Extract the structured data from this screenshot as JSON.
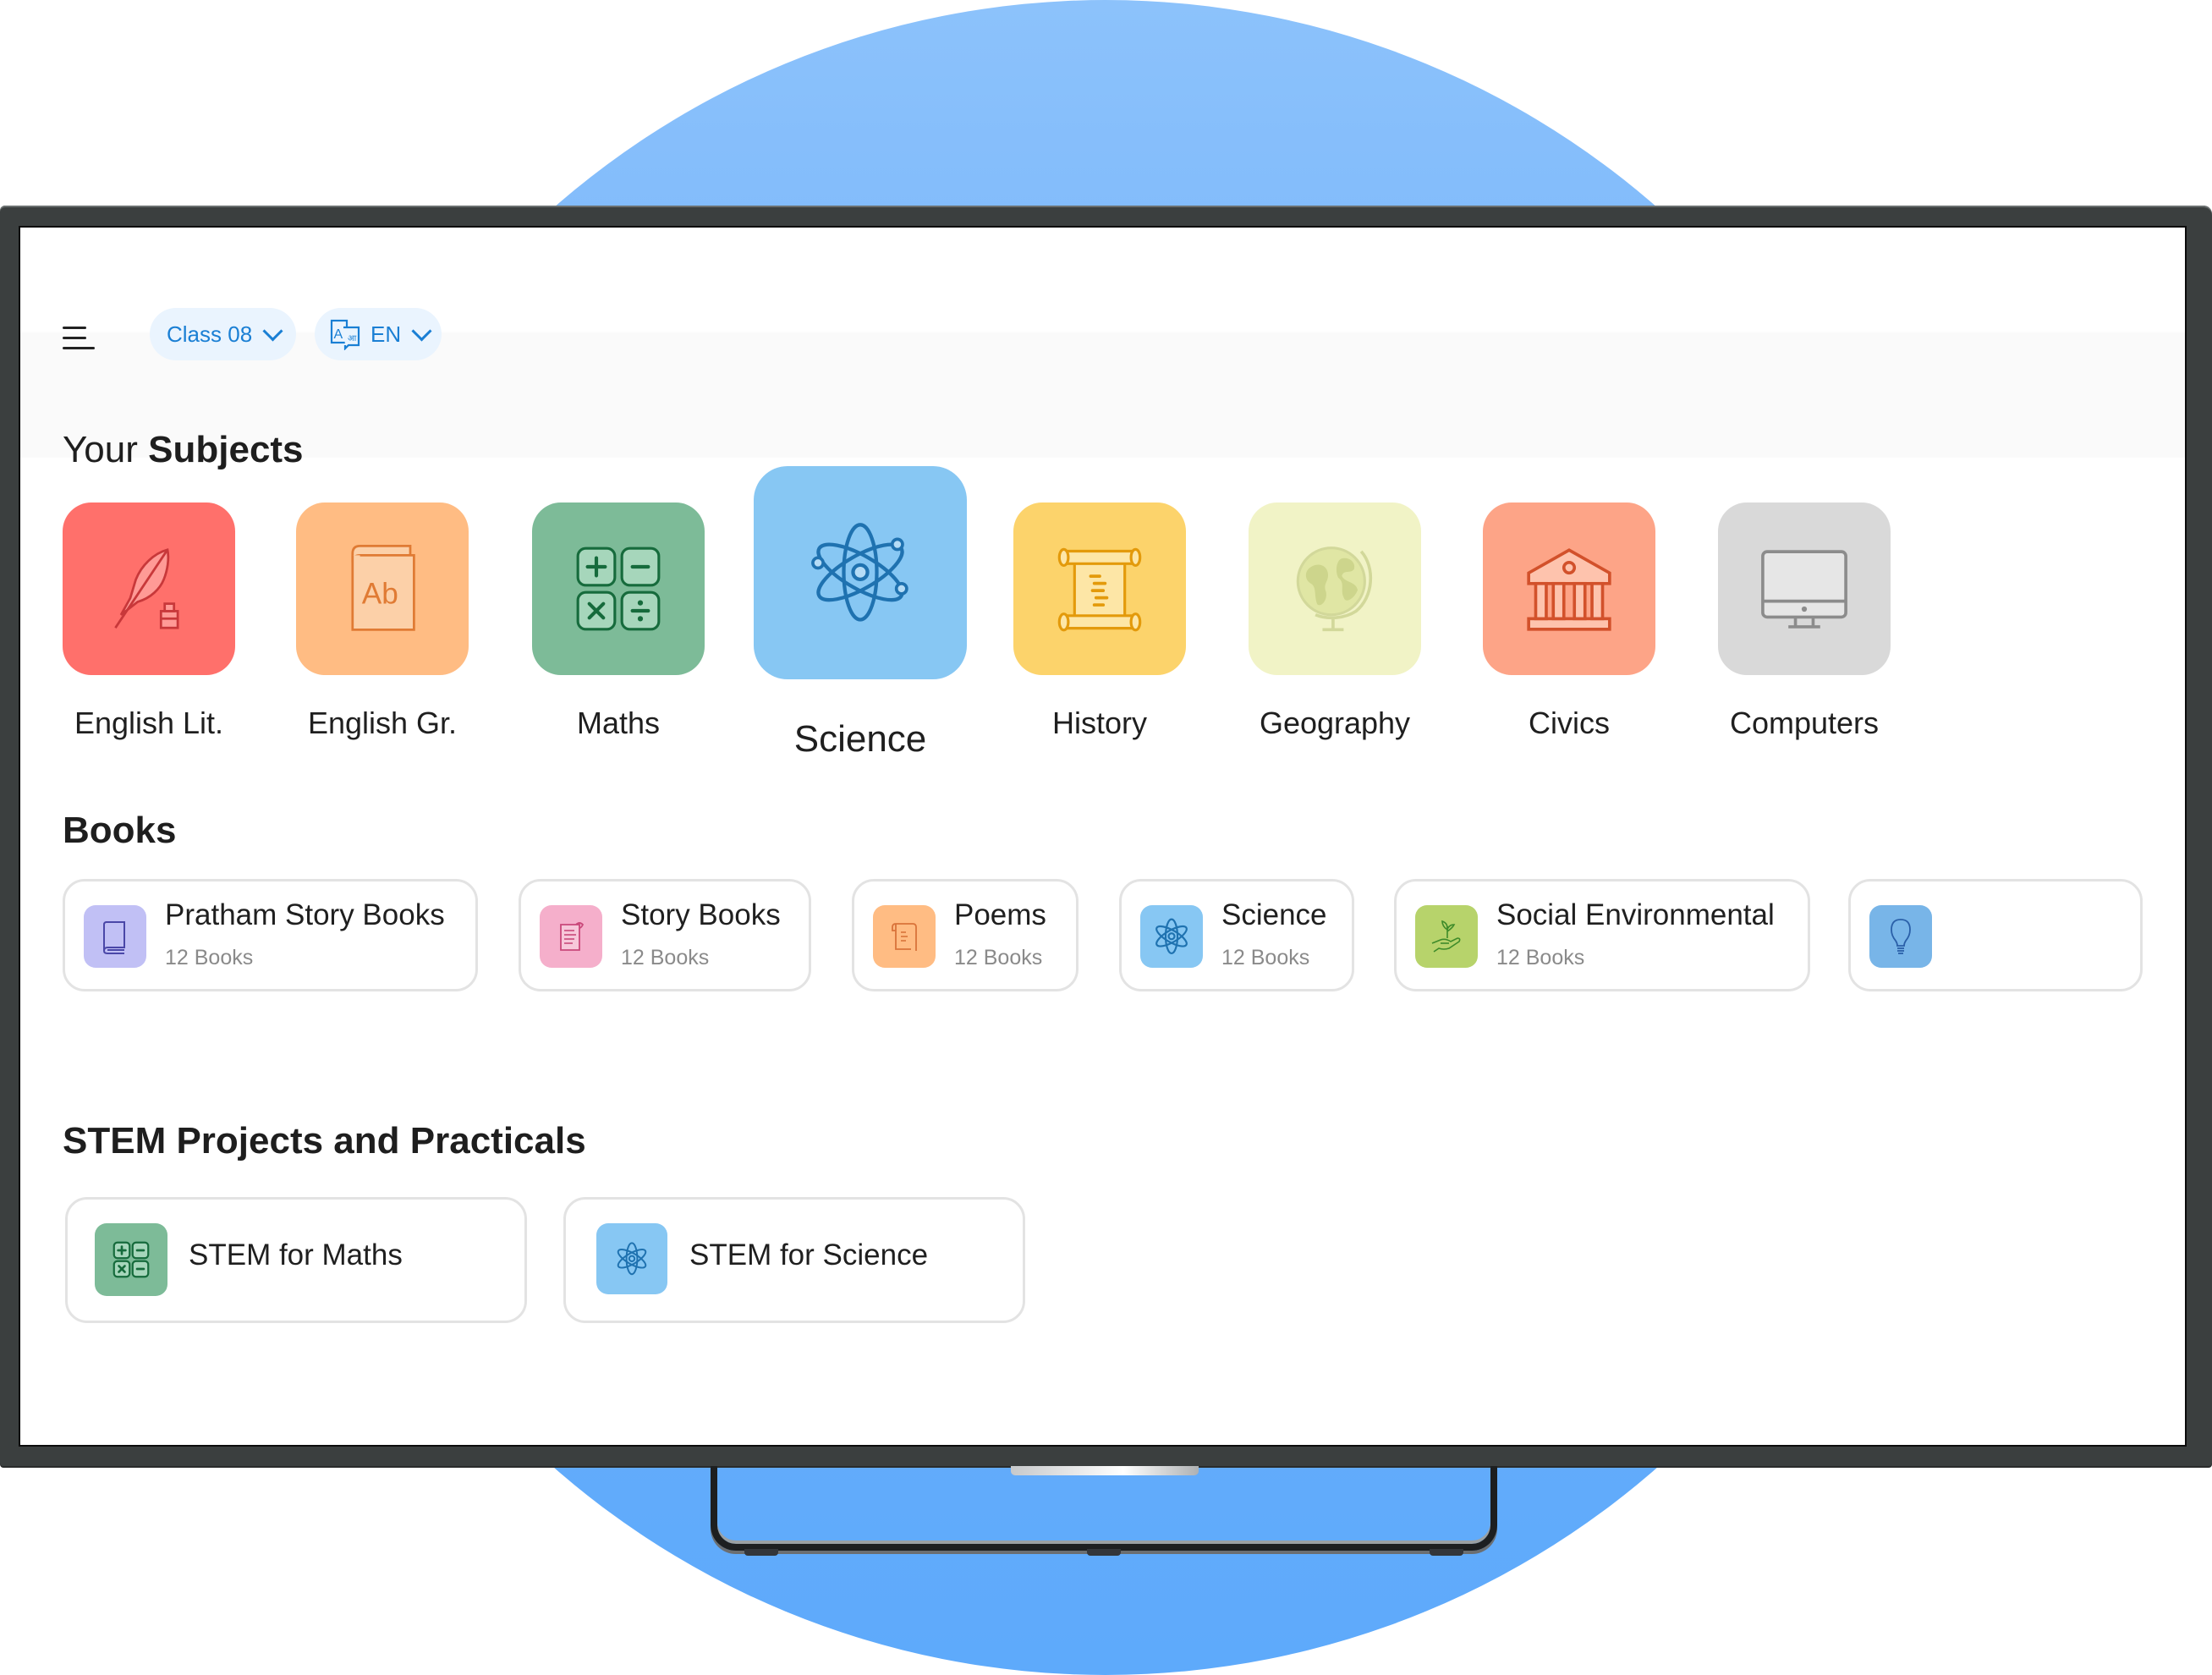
{
  "header": {
    "menu_icon": "hamburger-menu-icon",
    "class_selector": {
      "value": "Class 08",
      "icon": "chevron-down-icon"
    },
    "language_selector": {
      "value": "EN",
      "icon": "translate-icon"
    }
  },
  "subjects_section": {
    "title_prefix": "Your",
    "title_bold": "Subjects",
    "items": [
      {
        "label": "English Lit.",
        "icon": "quill-ink-icon",
        "color": "#ff706b"
      },
      {
        "label": "English Gr.",
        "icon": "grammar-book-icon",
        "color": "#ffbc83"
      },
      {
        "label": "Maths",
        "icon": "calculator-icon",
        "color": "#7dbb98"
      },
      {
        "label": "Science",
        "icon": "atom-icon",
        "color": "#87c7f3",
        "selected": true
      },
      {
        "label": "History",
        "icon": "scroll-icon",
        "color": "#fcd36b"
      },
      {
        "label": "Geography",
        "icon": "globe-icon",
        "color": "#f1f3c6"
      },
      {
        "label": "Civics",
        "icon": "government-building-icon",
        "color": "#fda487"
      },
      {
        "label": "Computers",
        "icon": "desktop-computer-icon",
        "color": "#d9d9d9"
      }
    ]
  },
  "books_section": {
    "title": "Books",
    "items": [
      {
        "title": "Pratham Story Books",
        "count": "12 Books",
        "icon": "book-icon",
        "color": "#c1c0f5"
      },
      {
        "title": "Story Books",
        "count": "12 Books",
        "icon": "document-icon",
        "color": "#f5afcb"
      },
      {
        "title": "Poems",
        "count": "12 Books",
        "icon": "poem-scroll-icon",
        "color": "#ffbc83"
      },
      {
        "title": "Science",
        "count": "12 Books",
        "icon": "atom-icon",
        "color": "#87c7f3"
      },
      {
        "title": "Social Environmental",
        "count": "12 Books",
        "icon": "plant-hand-icon",
        "color": "#b7d36b"
      },
      {
        "title": "",
        "count": "",
        "icon": "lightbulb-icon",
        "color": "#78b5e8"
      }
    ]
  },
  "stem_section": {
    "title": "STEM Projects and Practicals",
    "items": [
      {
        "title": "STEM for Maths",
        "icon": "calculator-icon",
        "color": "#7dbb98"
      },
      {
        "title": "STEM for Science",
        "icon": "atom-icon",
        "color": "#87c7f3"
      }
    ]
  }
}
